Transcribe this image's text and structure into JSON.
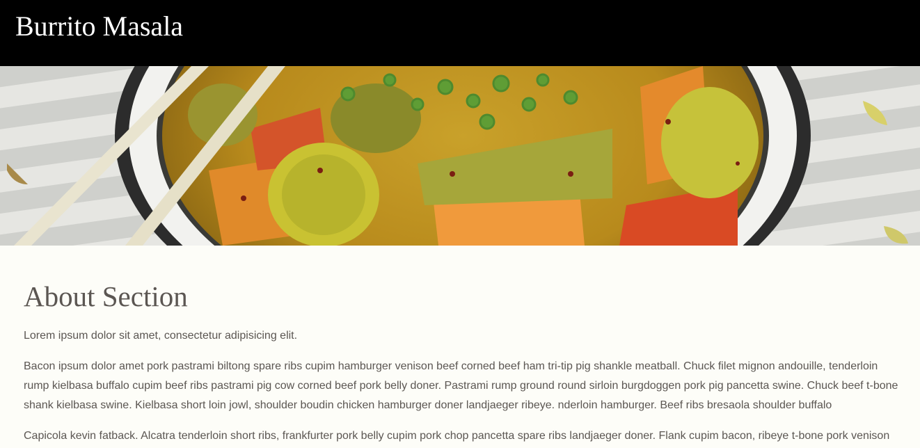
{
  "header": {
    "brand": "Burrito Masala"
  },
  "hero": {
    "image_subject": "vegetable curry bowl with chopsticks and microgreens"
  },
  "about": {
    "title": "About Section",
    "paragraphs": [
      "Lorem ipsum dolor sit amet, consectetur adipisicing elit.",
      "Bacon ipsum dolor amet pork pastrami biltong spare ribs cupim hamburger venison beef corned beef ham tri-tip pig shankle meatball. Chuck filet mignon andouille, tenderloin rump kielbasa buffalo cupim beef ribs pastrami pig cow corned beef pork belly doner. Pastrami rump ground round sirloin burgdoggen pork pig pancetta swine. Chuck beef t-bone shank kielbasa swine. Kielbasa short loin jowl, shoulder boudin chicken hamburger doner landjaeger ribeye. nderloin hamburger. Beef ribs bresaola shoulder buffalo",
      "Capicola kevin fatback. Alcatra tenderloin short ribs, frankfurter pork belly cupim pork chop pancetta spare ribs landjaeger doner. Flank cupim bacon, ribeye t-bone pork venison"
    ]
  },
  "colors": {
    "header_bg": "#000000",
    "brand_text": "#ffffff",
    "body_bg": "#fdfdf8",
    "body_text": "#5b5652"
  }
}
